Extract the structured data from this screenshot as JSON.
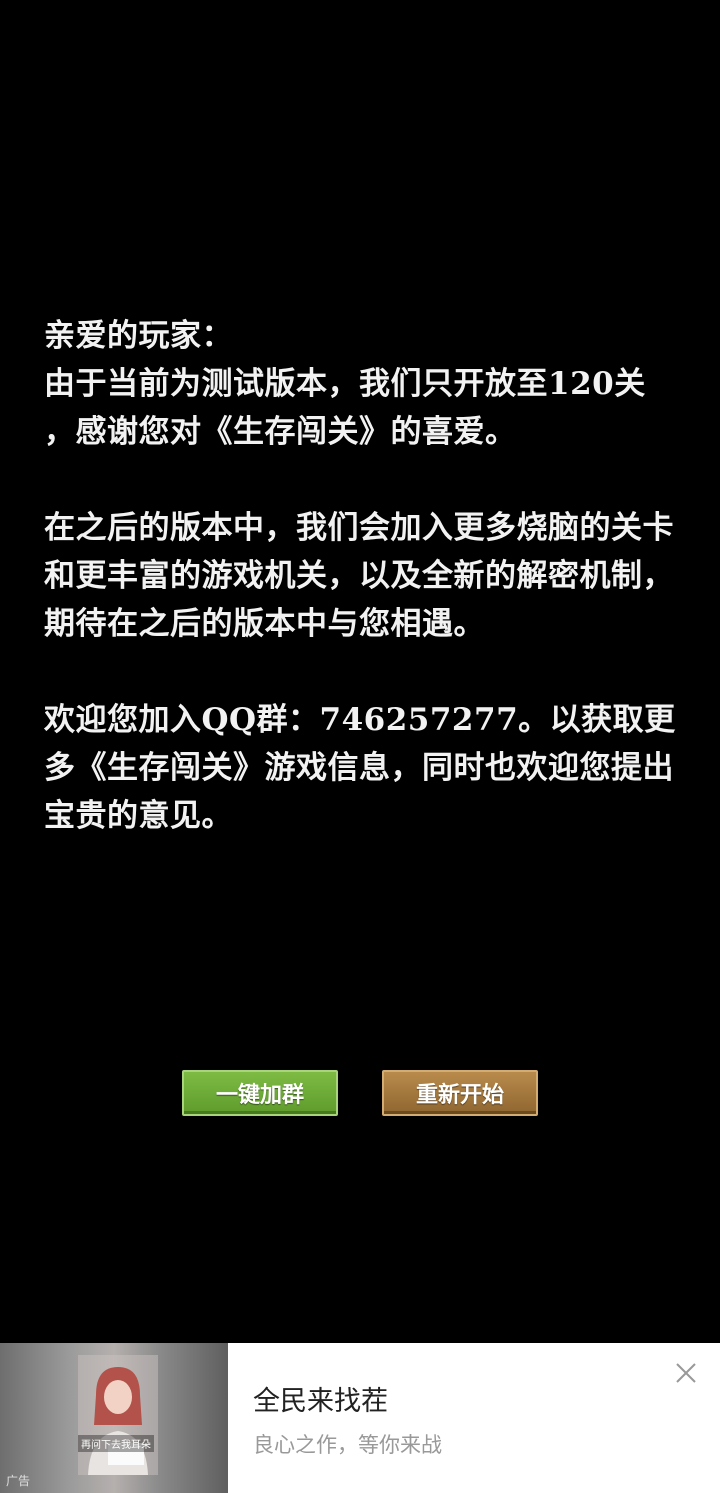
{
  "notice": {
    "paragraph1_line1": "亲爱的玩家：",
    "paragraph1_line2": "由于当前为测试版本，我们只开放至120关",
    "paragraph1_line3": "，感谢您对《生存闯关》的喜爱。",
    "paragraph2": "在之后的版本中，我们会加入更多烧脑的关卡和更丰富的游戏机关，以及全新的解密机制，期待在之后的版本中与您相遇。",
    "paragraph3": "欢迎您加入QQ群：746257277。以获取更多《生存闯关》游戏信息，同时也欢迎您提出宝贵的意见。"
  },
  "buttons": {
    "join_group": "一键加群",
    "restart": "重新开始"
  },
  "ad": {
    "thumbnail_caption": "再问下去我耳朵",
    "thumbnail_label": "广告",
    "title": "全民来找茬",
    "subtitle": "良心之作，等你来战",
    "close_icon": "close-icon"
  },
  "colors": {
    "background": "#000000",
    "text": "#f2f2f2",
    "button_green": "#6aa834",
    "button_brown": "#a47a3e"
  }
}
